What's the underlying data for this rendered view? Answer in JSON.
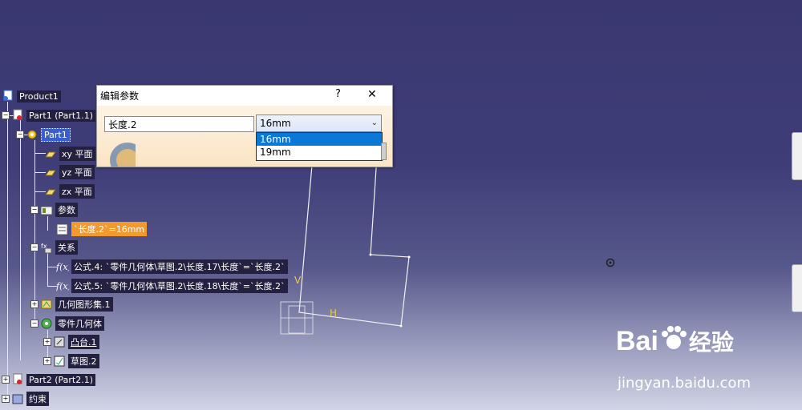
{
  "tree": {
    "product": "Product1",
    "part1": "Part1 (Part1.1)",
    "part1_body": "Part1",
    "xy_plane": "xy 平面",
    "yz_plane": "yz 平面",
    "zx_plane": "zx 平面",
    "parameters": "参数",
    "param_length": "`长度.2`=16mm",
    "relations": "关系",
    "formula4": "公式.4: `零件几何体\\草图.2\\长度.17\\长度`=`长度.2`",
    "formula5": "公式.5: `零件几何体\\草图.2\\长度.18\\长度`=`长度.2`",
    "geo_set": "几何图形集.1",
    "part_body": "零件几何体",
    "pad": "凸台.1",
    "sketch": "草图.2",
    "part2": "Part2 (Part2.1)",
    "constraints": "约束"
  },
  "dialog": {
    "title": "编辑参数",
    "help": "?",
    "close": "✕",
    "param_name": "长度.2",
    "selected_value": "16mm",
    "options": [
      "16mm",
      "19mm"
    ]
  },
  "axes": {
    "v": "V",
    "h": "H"
  },
  "watermark": {
    "brand": "Bai",
    "brand2": "经验",
    "url": "jingyan.baidu.com"
  },
  "colors": {
    "background": "#3f3d78",
    "highlight": "#f29a2e",
    "selection": "#0a78d7"
  }
}
